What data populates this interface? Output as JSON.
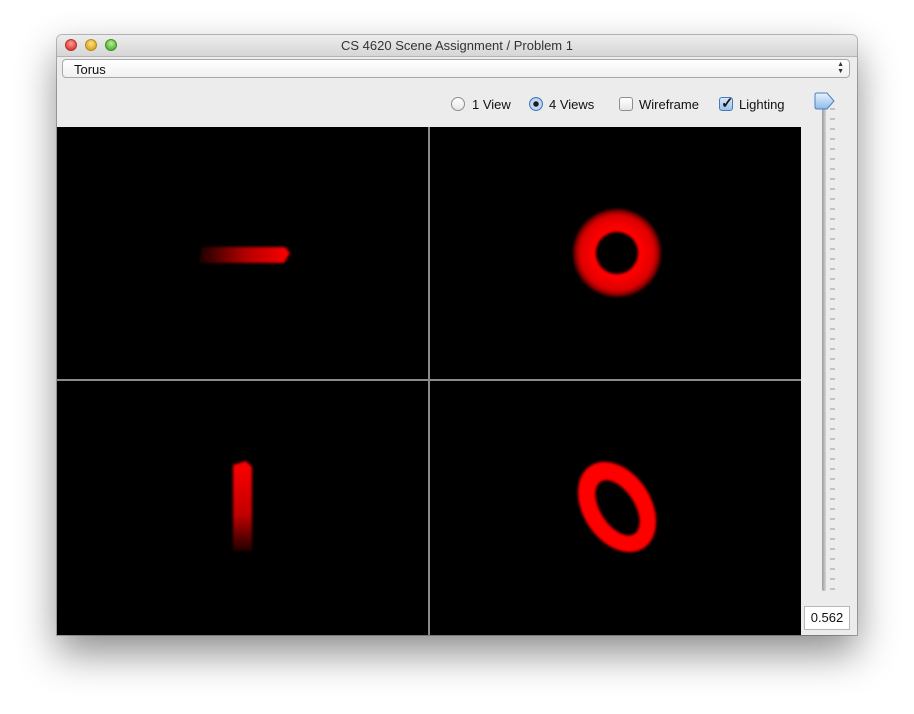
{
  "window": {
    "title": "CS 4620 Scene Assignment / Problem 1"
  },
  "scene_select": {
    "selected": "Torus"
  },
  "view_options": {
    "one_view_label": "1 View",
    "four_views_label": "4 Views",
    "selected_view": "4 Views",
    "wireframe_label": "Wireframe",
    "wireframe_checked": false,
    "lighting_label": "Lighting",
    "lighting_checked": true
  },
  "viewports": [
    {
      "name": "top-left",
      "object": "torus",
      "orientation": "edge-on horizontal"
    },
    {
      "name": "top-right",
      "object": "torus",
      "orientation": "face-on"
    },
    {
      "name": "bottom-left",
      "object": "torus",
      "orientation": "edge-on vertical"
    },
    {
      "name": "bottom-right",
      "object": "torus",
      "orientation": "perspective"
    }
  ],
  "slider": {
    "value_label": "0.562",
    "level": 0.97
  },
  "colors": {
    "object": "#ff0000",
    "background": "#000000",
    "divider": "#8a8a8a"
  }
}
